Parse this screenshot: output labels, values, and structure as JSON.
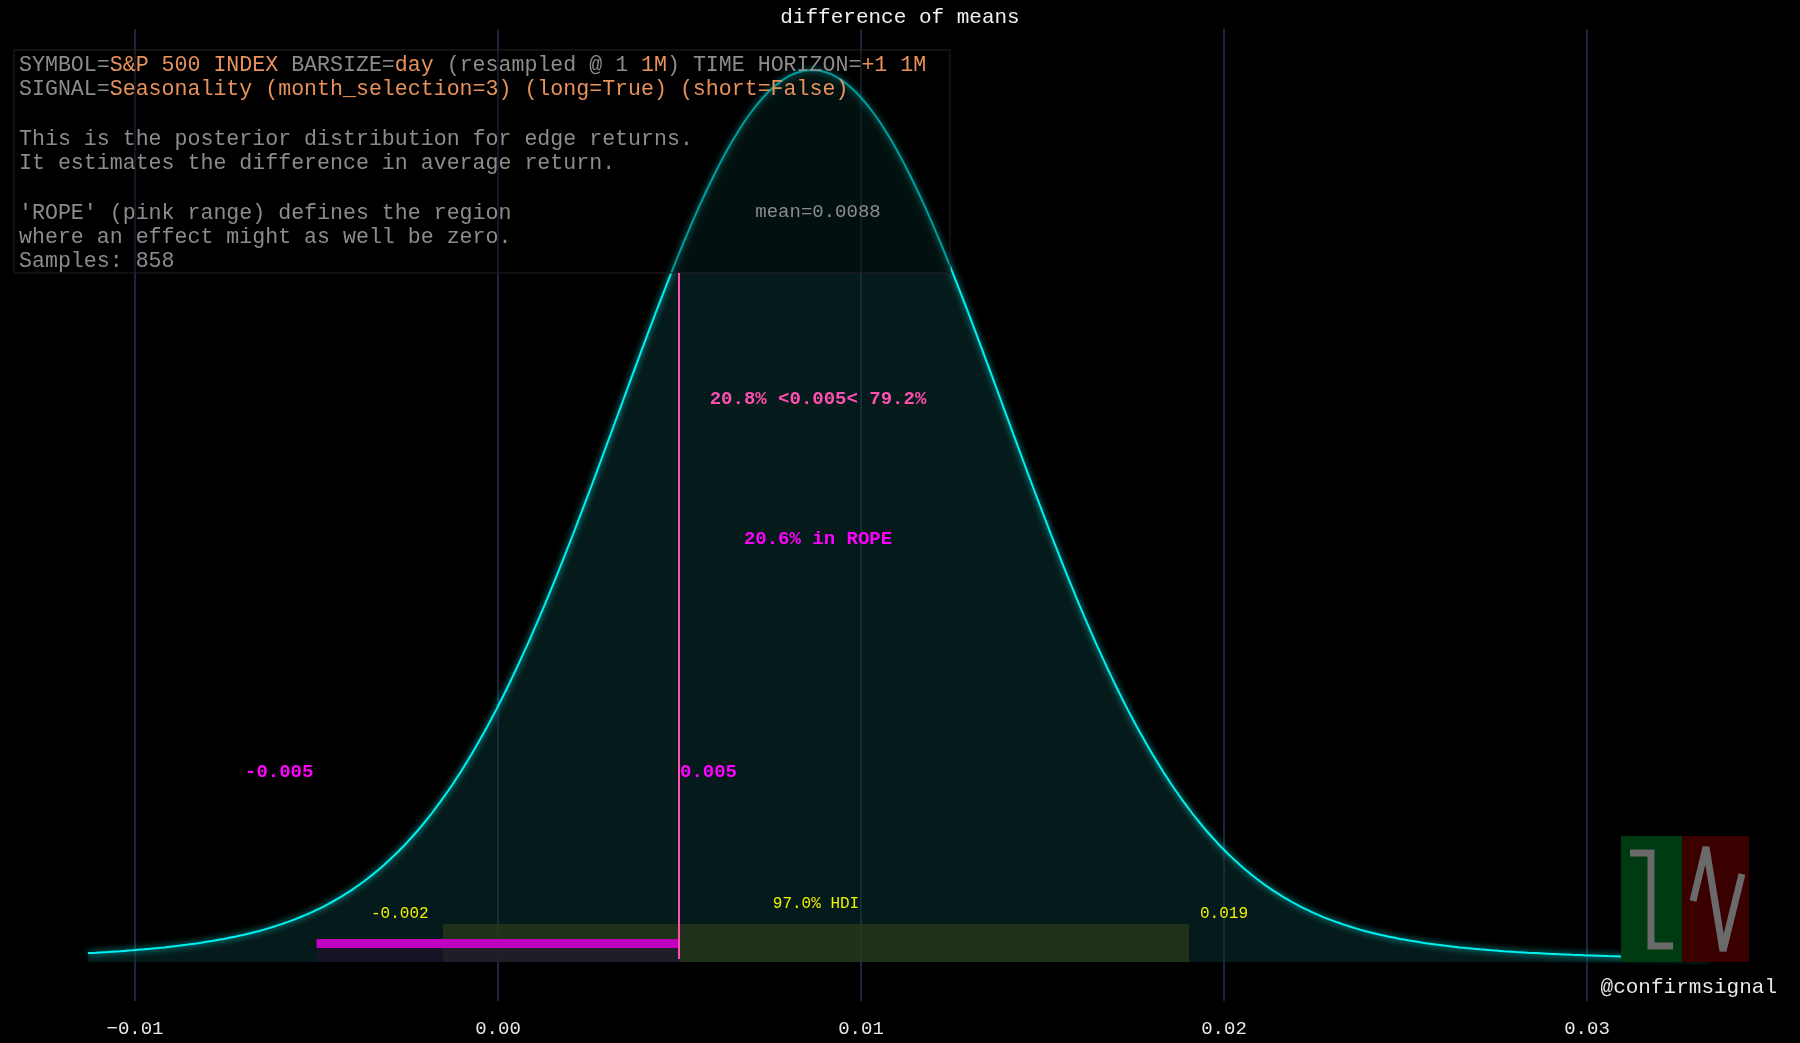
{
  "title": "difference of means",
  "info": {
    "paragraphs": [
      [
        [
          {
            "text": "SYMBOL=",
            "highlight": false
          },
          {
            "text": "S&P 500 INDEX",
            "highlight": true
          },
          {
            "text": " BARSIZE=",
            "highlight": false
          },
          {
            "text": "day",
            "highlight": true
          },
          {
            "text": " (resampled @ 1 ",
            "highlight": false
          },
          {
            "text": "1M",
            "highlight": true
          },
          {
            "text": ") TIME HORIZON=",
            "highlight": false
          },
          {
            "text": "+1 1M",
            "highlight": true
          }
        ],
        [
          {
            "text": "SIGNAL=",
            "highlight": false
          },
          {
            "text": "Seasonality (month_selection=3) (long=True) (short=False)",
            "highlight": true
          }
        ]
      ],
      [
        [
          {
            "text": "This is the posterior distribution for edge returns.",
            "highlight": false
          }
        ],
        [
          {
            "text": "It estimates the difference in average return.",
            "highlight": false
          }
        ]
      ],
      [
        [
          {
            "text": "'ROPE' (pink range) defines the region",
            "highlight": false
          }
        ],
        [
          {
            "text": "where an effect might as well be zero.",
            "highlight": false
          }
        ],
        [
          {
            "text": "Samples: 858",
            "highlight": false
          }
        ]
      ]
    ]
  },
  "mean_label": "mean=0.0088",
  "split_label": "20.8% <0.005< 79.2%",
  "rope_label": "20.6% in ROPE",
  "rope_low": "-0.005",
  "rope_high": "0.005",
  "hdi": {
    "label": "97.0% HDI",
    "low": "-0.002",
    "high": "0.019"
  },
  "xticks": [
    "−0.01",
    "0.00",
    "0.01",
    "0.02",
    "0.03"
  ],
  "credit": "@confirmsignal"
}
